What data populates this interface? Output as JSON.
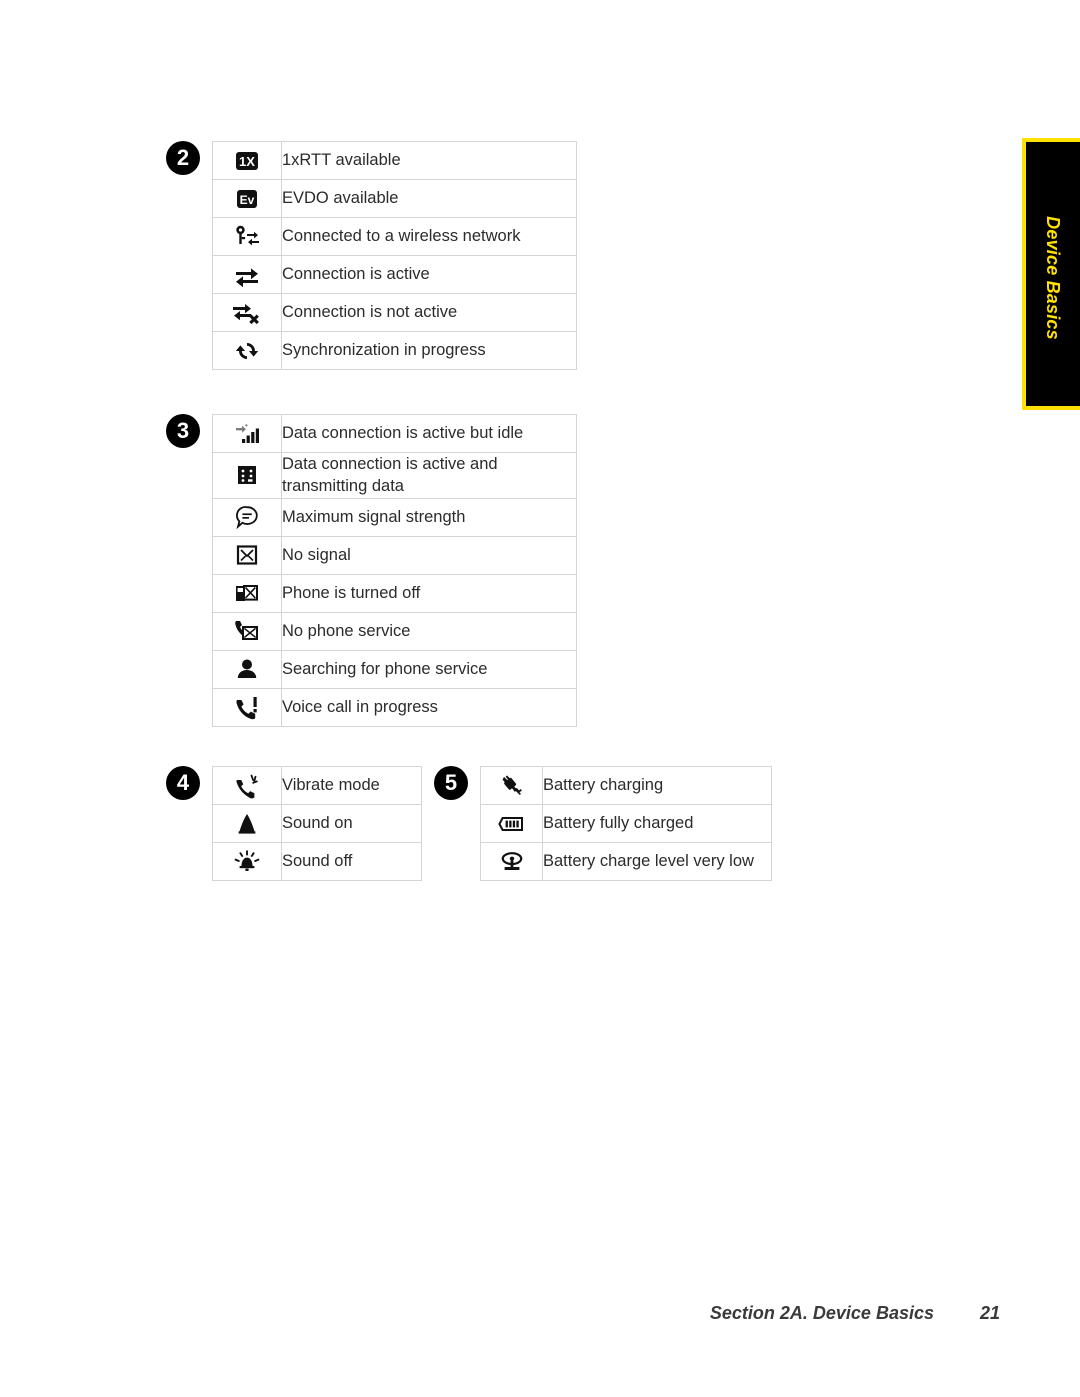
{
  "side_tab": {
    "label": "Device Basics",
    "background": "#000000",
    "border_color": "#ffe000",
    "text_color": "#ffe000"
  },
  "footer": {
    "section": "Section 2A. Device Basics",
    "page": "21"
  },
  "blocks": [
    {
      "marker": "2",
      "rows": [
        {
          "icon": "1x-badge-icon",
          "label": "1xRTT available"
        },
        {
          "icon": "evdo-badge-icon",
          "label": "EVDO available"
        },
        {
          "icon": "wireless-network-connected-icon",
          "label": "Connected to a wireless network"
        },
        {
          "icon": "connection-active-icon",
          "label": "Connection is active"
        },
        {
          "icon": "connection-not-active-icon",
          "label": "Connection is not active"
        },
        {
          "icon": "sync-in-progress-icon",
          "label": "Synchronization in progress"
        }
      ]
    },
    {
      "marker": "3",
      "rows": [
        {
          "icon": "data-connection-idle-icon",
          "label": "Data connection is active but idle"
        },
        {
          "icon": "data-transmitting-icon",
          "label": "Data connection is active and\ntransmitting data"
        },
        {
          "icon": "maximum-signal-strength-icon",
          "label": "Maximum signal strength"
        },
        {
          "icon": "no-signal-icon",
          "label": "No signal"
        },
        {
          "icon": "phone-off-icon",
          "label": "Phone is turned off"
        },
        {
          "icon": "no-phone-service-icon",
          "label": "No phone service"
        },
        {
          "icon": "searching-for-service-icon",
          "label": "Searching for phone service"
        },
        {
          "icon": "voice-call-in-progress-icon",
          "label": "Voice call in progress"
        }
      ]
    },
    {
      "marker": "4",
      "rows": [
        {
          "icon": "vibrate-mode-icon",
          "label": "Vibrate mode"
        },
        {
          "icon": "sound-on-icon",
          "label": "Sound on"
        },
        {
          "icon": "sound-off-icon",
          "label": "Sound off"
        }
      ]
    },
    {
      "marker": "5",
      "rows": [
        {
          "icon": "battery-charging-icon",
          "label": "Battery charging"
        },
        {
          "icon": "battery-full-icon",
          "label": "Battery fully charged"
        },
        {
          "icon": "battery-very-low-icon",
          "label": "Battery charge level very low"
        }
      ]
    }
  ]
}
